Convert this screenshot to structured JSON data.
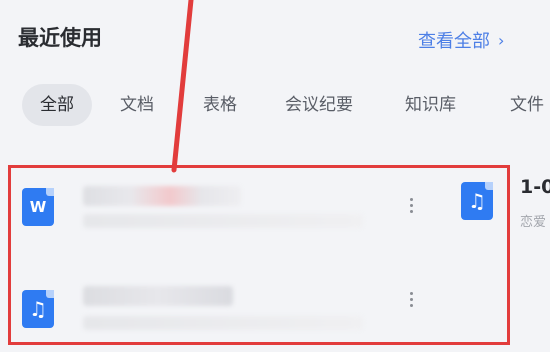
{
  "header": {
    "title": "最近使用",
    "view_all": "查看全部",
    "chevron": "›"
  },
  "tabs": [
    {
      "label": "全部",
      "active": true
    },
    {
      "label": "文档"
    },
    {
      "label": "表格"
    },
    {
      "label": "会议纪要"
    },
    {
      "label": "知识库"
    },
    {
      "label": "文件"
    }
  ],
  "files": [
    {
      "icon": "word-doc-icon",
      "icon_glyph": "W"
    },
    {
      "icon": "audio-file-icon",
      "icon_glyph": "♫"
    }
  ],
  "peek": {
    "icon_glyph": "♫",
    "title": "1-0",
    "subtitle": "恋爱"
  },
  "colors": {
    "accent": "#4d7fe6",
    "file_icon": "#2f7bf2",
    "highlight": "#e23c3c"
  }
}
